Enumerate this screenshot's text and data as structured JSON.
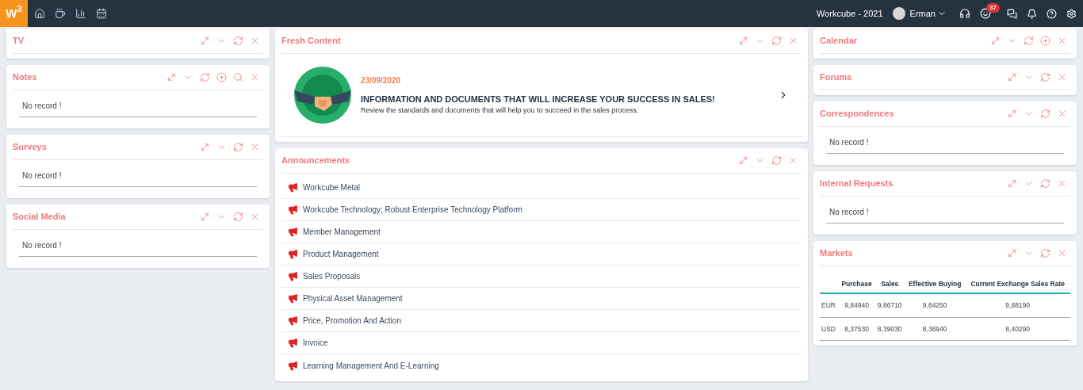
{
  "topbar": {
    "logo": "W$^{3}$",
    "company": "Workcube - 2021",
    "user": "Erman",
    "notification_count": "37"
  },
  "columns": [
    [
      {
        "title": "TV",
        "can_add": false,
        "can_search": false
      },
      {
        "title": "Notes",
        "can_add": true,
        "can_search": true,
        "body": {
          "kind": "empty",
          "text": "No record !"
        }
      },
      {
        "title": "Surveys",
        "can_add": false,
        "can_search": false,
        "body": {
          "kind": "empty",
          "text": "No record !"
        }
      },
      {
        "title": "Social Media",
        "can_add": false,
        "can_search": false,
        "body": {
          "kind": "empty",
          "text": "No record !"
        }
      }
    ],
    [
      {
        "title": "Fresh Content",
        "can_add": false,
        "can_search": false,
        "body": {
          "kind": "fresh",
          "date": "23/09/2020",
          "headline": "INFORMATION AND DOCUMENTS THAT WILL INCREASE YOUR SUCCESS IN SALES!",
          "text": "Review the standards and documents that will help you to succeed in the sales process."
        }
      },
      {
        "title": "Announcements",
        "can_add": false,
        "can_search": false,
        "body": {
          "kind": "list",
          "items": [
            "Workcube Metal",
            "Workcube Technology; Robust Enterprise Technology Platform",
            "Member Management",
            "Product Management",
            "Sales Proposals",
            "Physical Asset Management",
            "Price, Promotion And Action",
            "Invoice",
            "Learning Management And E-Learning"
          ]
        }
      }
    ],
    [
      {
        "title": "Calendar",
        "can_add": true,
        "can_search": false
      },
      {
        "title": "Forums",
        "can_add": false,
        "can_search": false
      },
      {
        "title": "Correspondences",
        "can_add": false,
        "can_search": false,
        "body": {
          "kind": "empty",
          "text": "No record !"
        }
      },
      {
        "title": "Internal Requests",
        "can_add": false,
        "can_search": false,
        "body": {
          "kind": "empty",
          "text": "No record !"
        }
      },
      {
        "title": "Markets",
        "can_add": false,
        "can_search": false,
        "body": {
          "kind": "table",
          "columns": [
            "",
            "Purchase",
            "Sales",
            "Effective Buying",
            "Current Exchange Sales Rate"
          ],
          "rows": [
            [
              "EUR",
              "9,84940",
              "9,86710",
              "9,84250",
              "9,88190"
            ],
            [
              "USD",
              "8,37530",
              "8,39030",
              "8,36940",
              "8,40290"
            ]
          ]
        }
      }
    ]
  ]
}
